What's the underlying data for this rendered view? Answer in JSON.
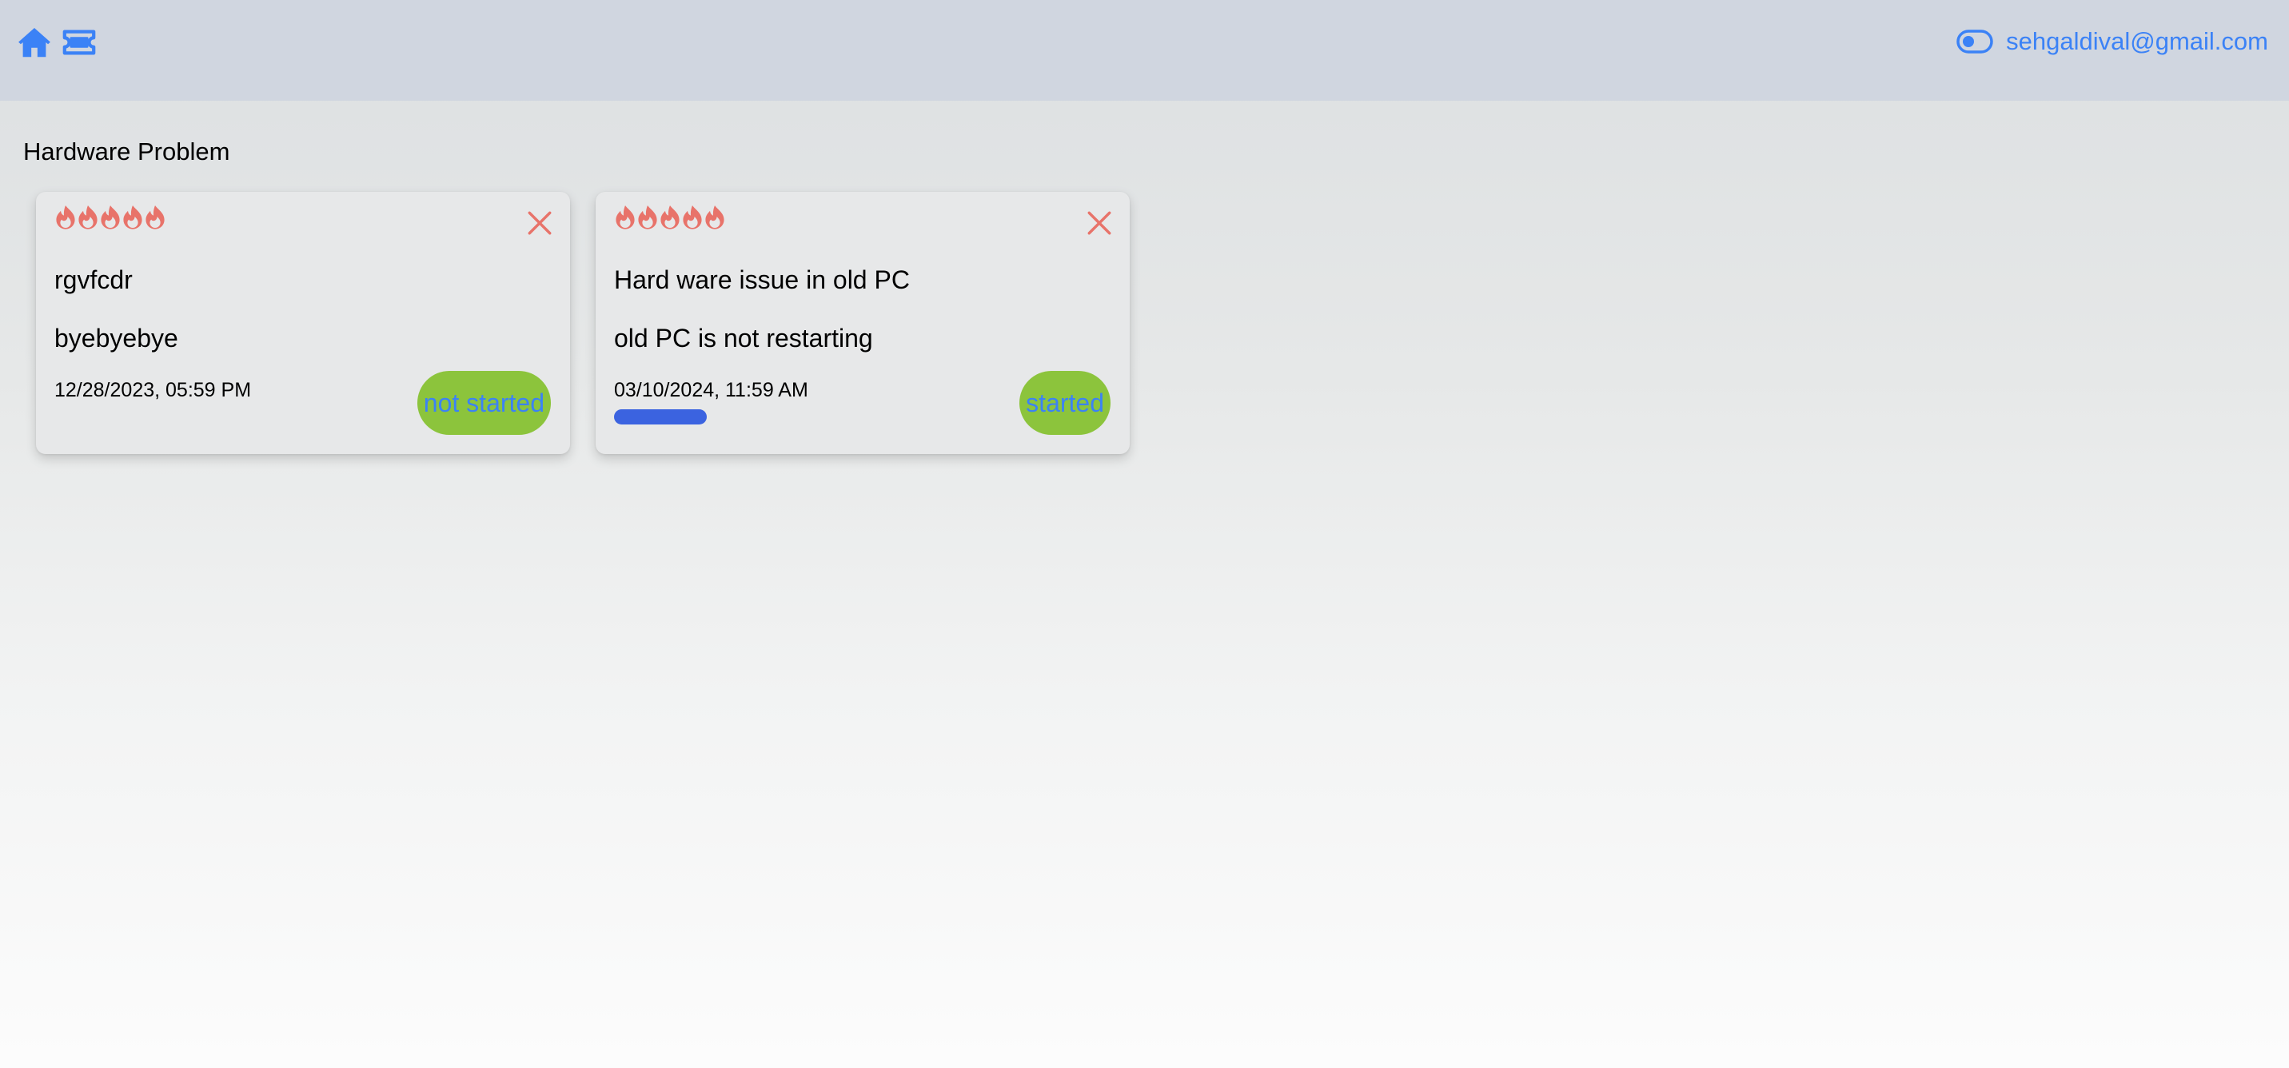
{
  "header": {
    "user_email": "sehgaldival@gmail.com",
    "icons": [
      "home-icon",
      "ticket-icon",
      "toggle-icon"
    ]
  },
  "section": {
    "title": "Hardware Problem"
  },
  "cards": [
    {
      "title": "rgvfcdr",
      "description": "byebyebye",
      "date": "12/28/2023, 05:59 PM",
      "status": "not started",
      "priority": 5
    },
    {
      "title": "Hard ware issue in old PC",
      "description": "old PC is not restarting",
      "date": "03/10/2024, 11:59 AM",
      "status": "started",
      "priority": 5,
      "progress_percent": 10
    }
  ],
  "colors": {
    "accent": "#3b82f6",
    "fire": "#e8736a",
    "status_bg": "#8cc43c",
    "progress": "#3b63e0",
    "topbar": "#d0d6e0"
  }
}
